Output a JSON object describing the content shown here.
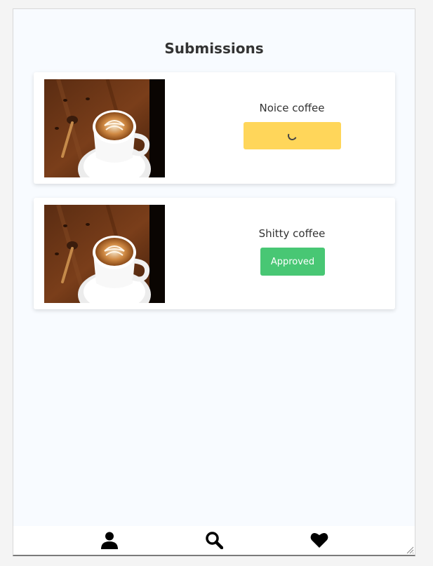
{
  "page": {
    "title": "Submissions"
  },
  "submissions": [
    {
      "title": "Noice coffee",
      "status": "pending",
      "image": "latte-art-coffee-cup"
    },
    {
      "title": "Shitty coffee",
      "status": "approved",
      "status_label": "Approved",
      "image": "latte-art-coffee-cup"
    }
  ],
  "nav": {
    "icons": [
      "user-icon",
      "search-icon",
      "heart-icon"
    ]
  },
  "colors": {
    "background": "#f8fbff",
    "pending": "#ffd65a",
    "approved": "#48c774"
  }
}
